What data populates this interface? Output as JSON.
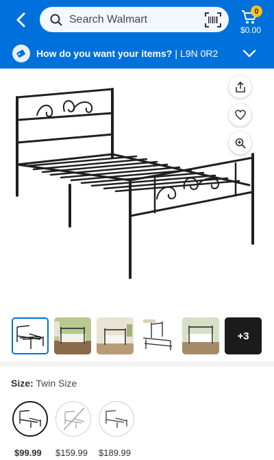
{
  "header": {
    "search_placeholder": "Search Walmart",
    "cart_count": "0",
    "cart_total": "$0.00"
  },
  "delivery": {
    "prompt": "How do you want your items?",
    "separator": "|",
    "postal_code": "L9N 0R2"
  },
  "gallery": {
    "more_count": "+3"
  },
  "size": {
    "label": "Size:",
    "value": "Twin Size",
    "options": [
      {
        "price": "$99.99",
        "state": "selected"
      },
      {
        "price": "$159.99",
        "state": "unavailable"
      },
      {
        "price": "$189.99",
        "state": "available"
      }
    ]
  },
  "colors": {
    "brand_blue": "#0071dc",
    "spark_yellow": "#ffc220"
  }
}
